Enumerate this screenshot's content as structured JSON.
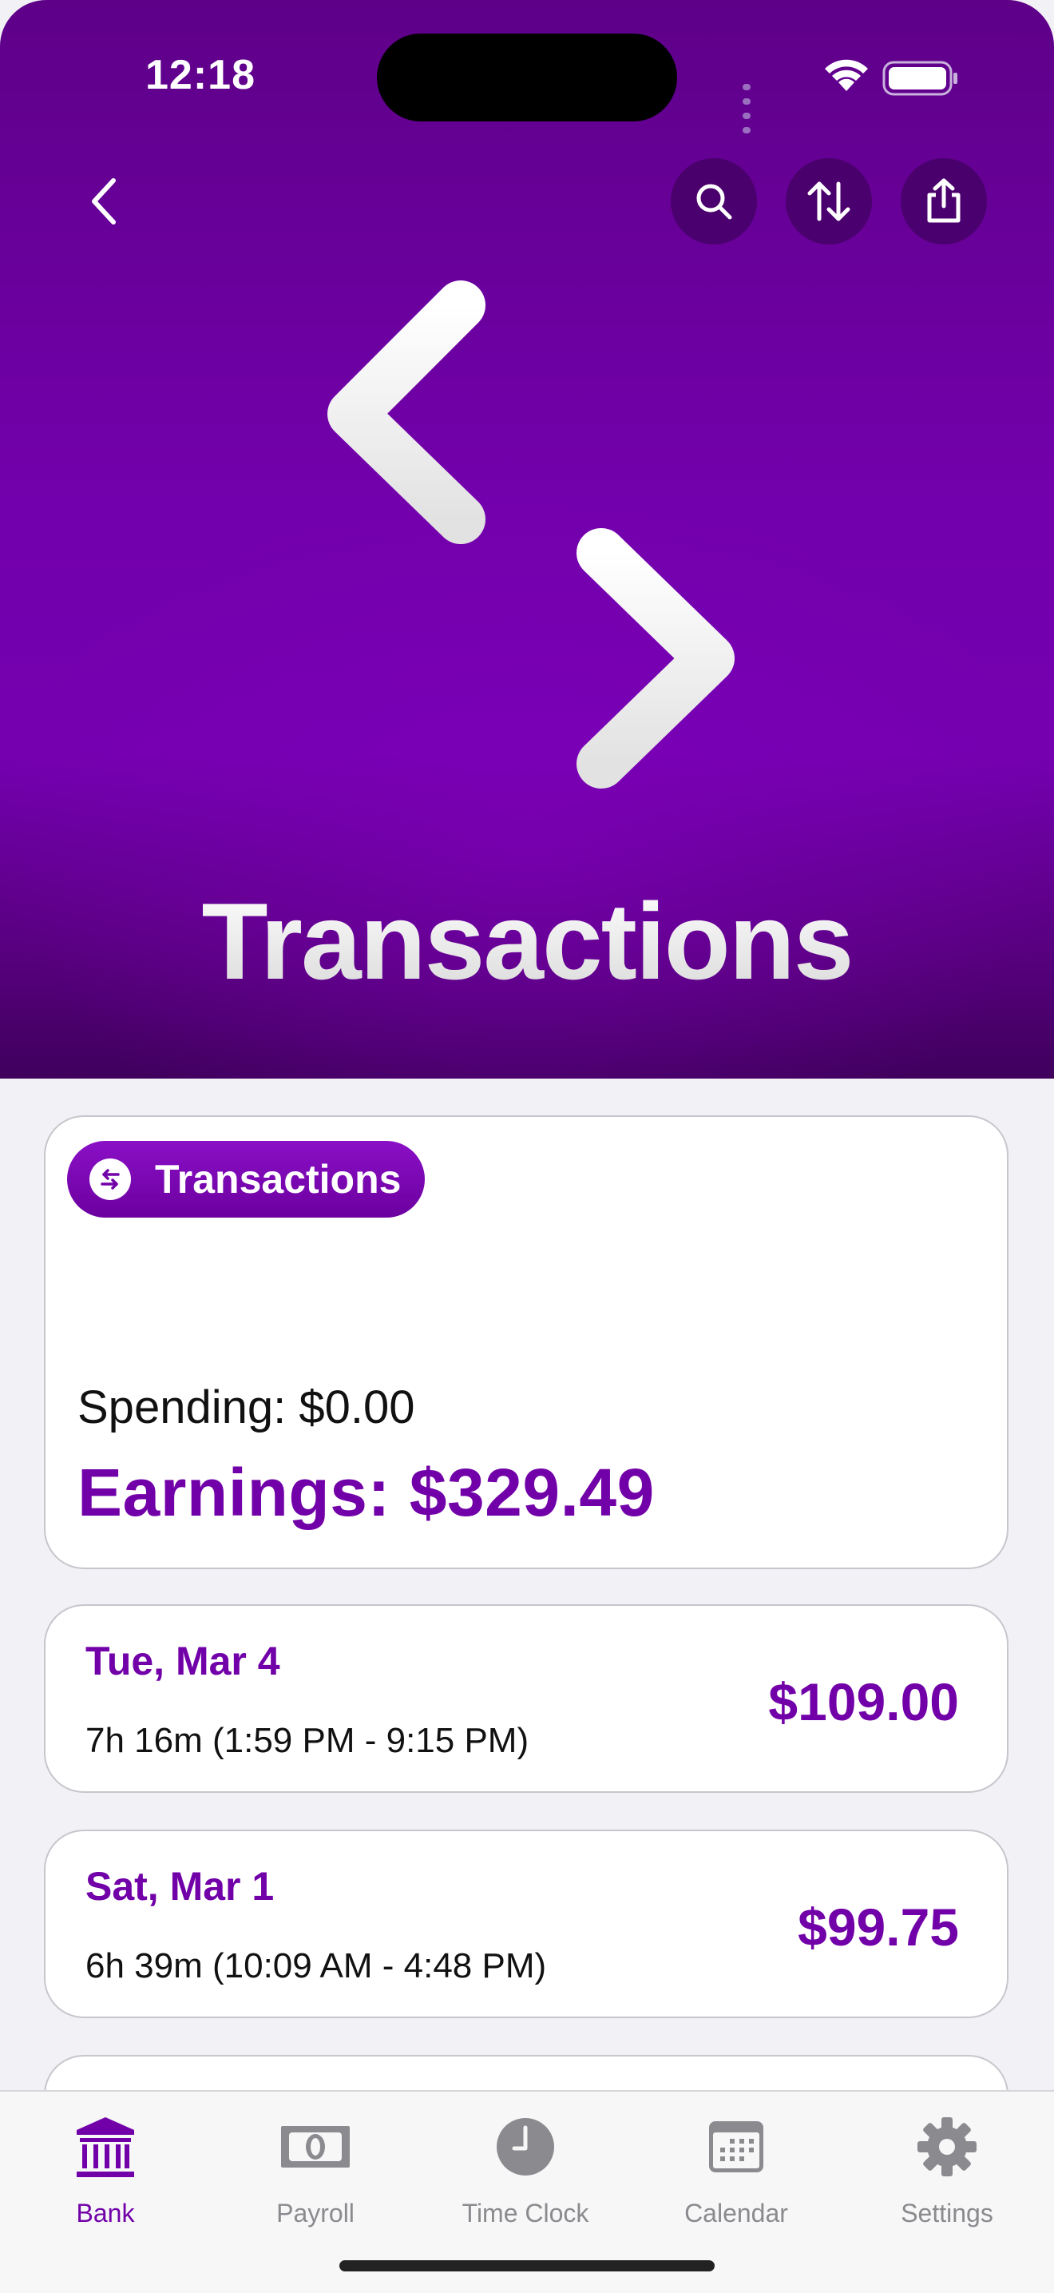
{
  "status_bar": {
    "time": "12:18"
  },
  "hero": {
    "title": "Transactions"
  },
  "summary": {
    "badge_label": "Transactions",
    "spending": "Spending: $0.00",
    "earnings": "Earnings: $329.49"
  },
  "transactions": [
    {
      "date": "Tue, Mar 4",
      "detail": "7h 16m (1:59 PM - 9:15 PM)",
      "amount": "$109.00"
    },
    {
      "date": "Sat, Mar 1",
      "detail": "6h 39m (10:09 AM - 4:48 PM)",
      "amount": "$99.75"
    }
  ],
  "tabbar": {
    "items": [
      {
        "label": "Bank",
        "icon": "bank-icon",
        "active": true
      },
      {
        "label": "Payroll",
        "icon": "banknote-icon",
        "active": false
      },
      {
        "label": "Time Clock",
        "icon": "clock-icon",
        "active": false
      },
      {
        "label": "Calendar",
        "icon": "calendar-icon",
        "active": false
      },
      {
        "label": "Settings",
        "icon": "gear-icon",
        "active": false
      }
    ]
  },
  "colors": {
    "accent": "#7100a8",
    "hero_top": "#5e0088",
    "background": "#f2f1f6"
  }
}
